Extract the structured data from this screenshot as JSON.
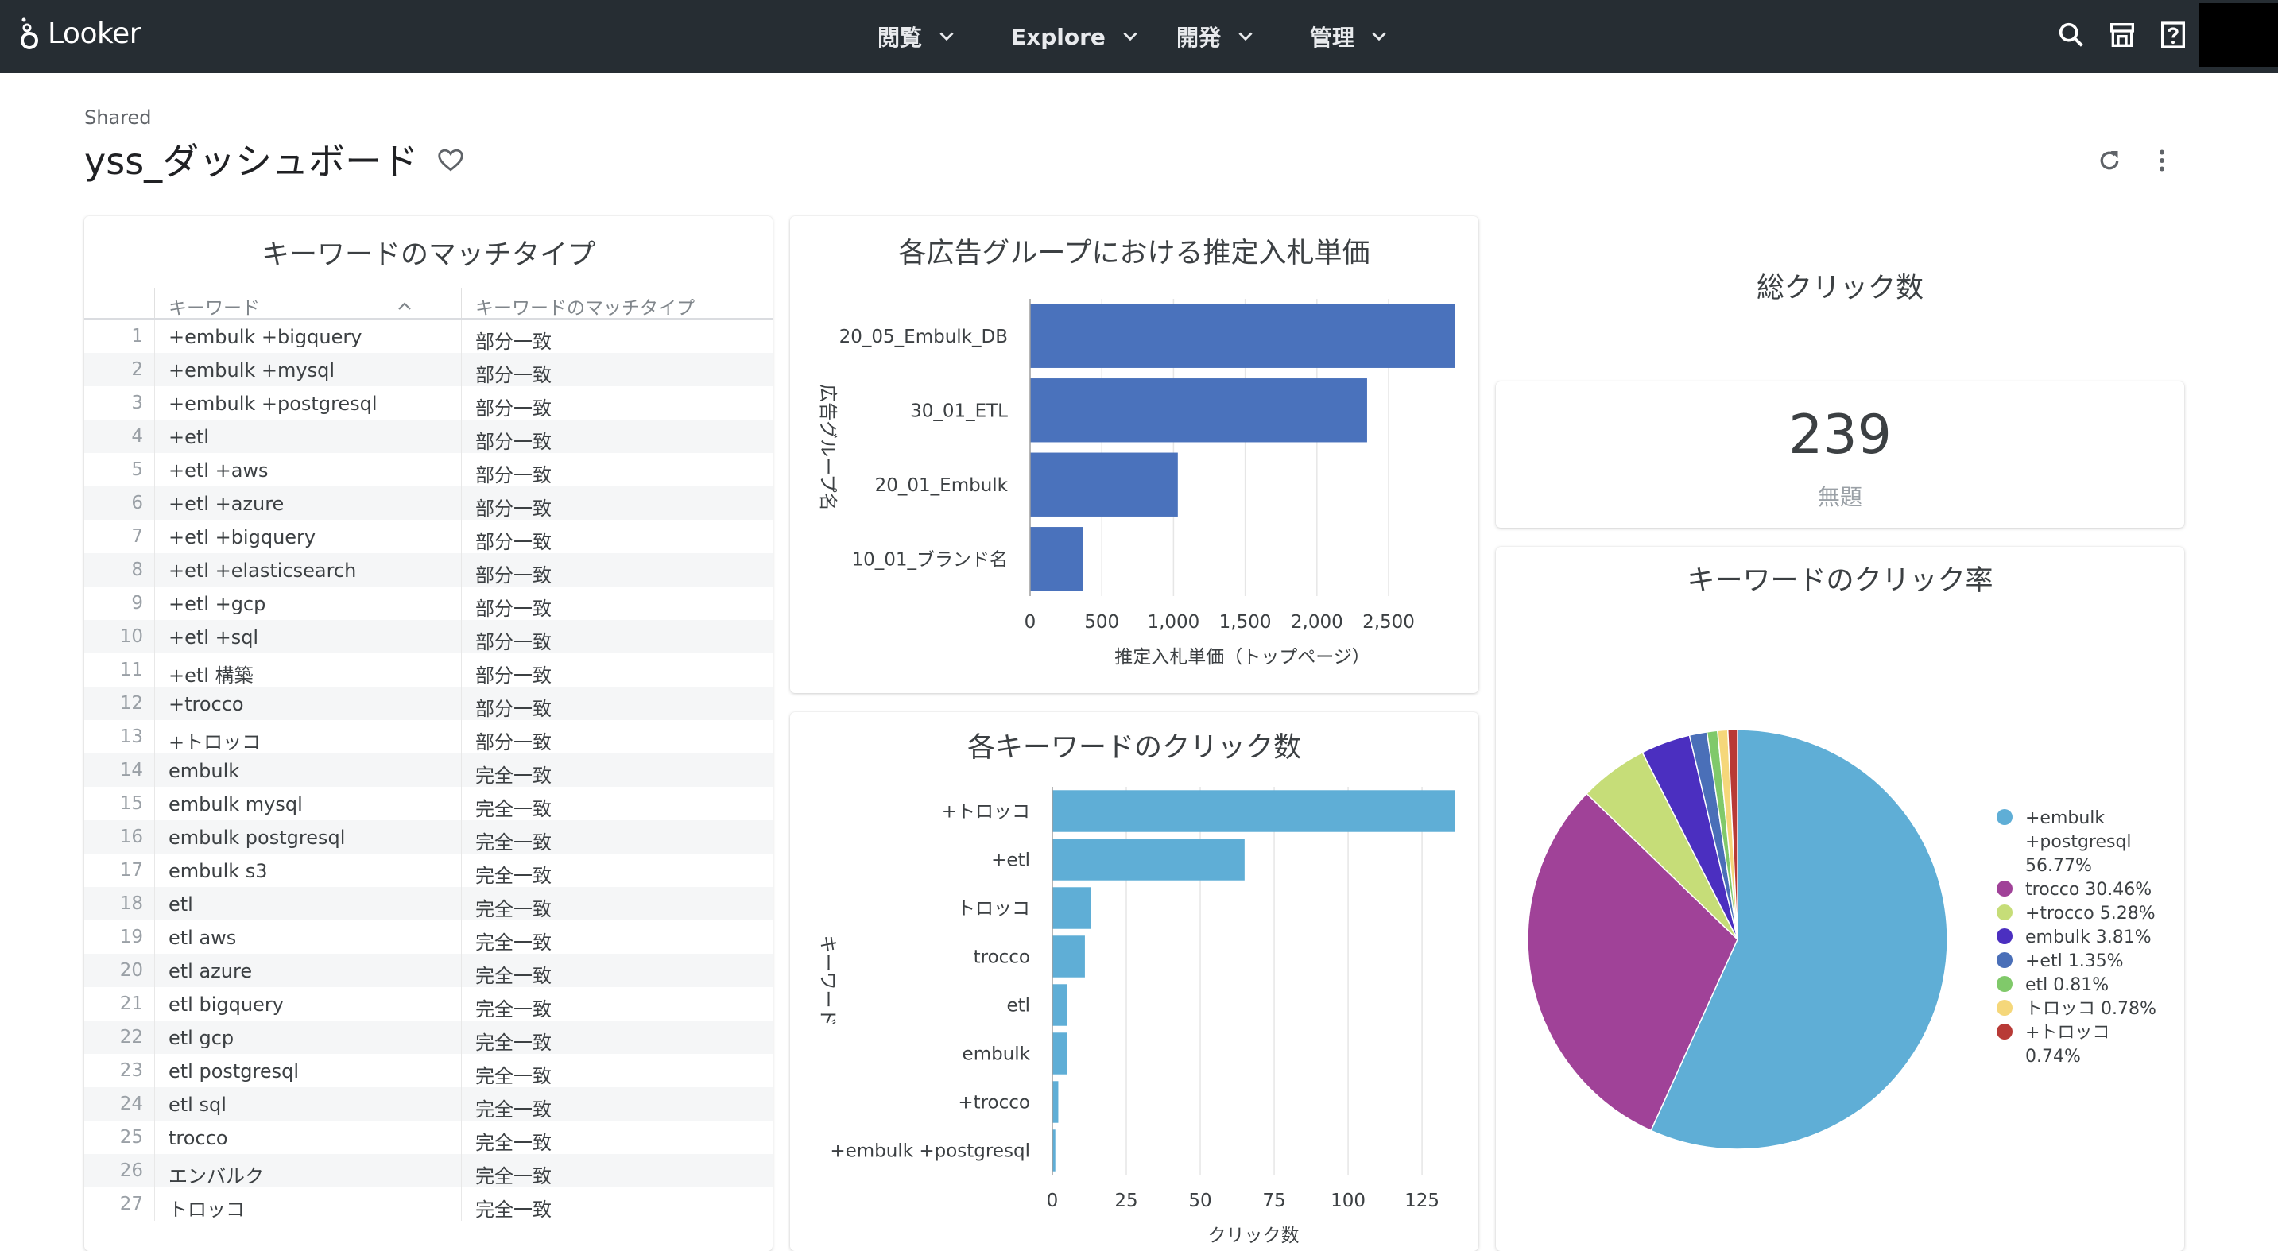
{
  "app": {
    "name": "Looker"
  },
  "nav": [
    {
      "label": "閲覧"
    },
    {
      "label": "Explore"
    },
    {
      "label": "開発"
    },
    {
      "label": "管理"
    }
  ],
  "header": {
    "breadcrumb": "Shared",
    "title": "yss_ダッシュボード"
  },
  "colors": {
    "topbar": "#262d33",
    "bid_bar": "#4a72bc",
    "click_bar": "#5faed6",
    "pie": [
      "#5faed6",
      "#a04298",
      "#c6dd78",
      "#4b2fc0",
      "#4a6fb8",
      "#80c96a",
      "#f5d77a",
      "#b83a36"
    ]
  },
  "table": {
    "title": "キーワードのマッチタイプ",
    "columns": [
      "キーワード",
      "キーワードのマッチタイプ"
    ],
    "rows": [
      {
        "n": "1",
        "keyword": "+embulk +bigquery",
        "type": "部分一致"
      },
      {
        "n": "2",
        "keyword": "+embulk +mysql",
        "type": "部分一致"
      },
      {
        "n": "3",
        "keyword": "+embulk +postgresql",
        "type": "部分一致"
      },
      {
        "n": "4",
        "keyword": "+etl",
        "type": "部分一致"
      },
      {
        "n": "5",
        "keyword": "+etl +aws",
        "type": "部分一致"
      },
      {
        "n": "6",
        "keyword": "+etl +azure",
        "type": "部分一致"
      },
      {
        "n": "7",
        "keyword": "+etl +bigquery",
        "type": "部分一致"
      },
      {
        "n": "8",
        "keyword": "+etl +elasticsearch",
        "type": "部分一致"
      },
      {
        "n": "9",
        "keyword": "+etl +gcp",
        "type": "部分一致"
      },
      {
        "n": "10",
        "keyword": "+etl +sql",
        "type": "部分一致"
      },
      {
        "n": "11",
        "keyword": "+etl 構築",
        "type": "部分一致"
      },
      {
        "n": "12",
        "keyword": "+trocco",
        "type": "部分一致"
      },
      {
        "n": "13",
        "keyword": "+トロッコ",
        "type": "部分一致"
      },
      {
        "n": "14",
        "keyword": "embulk",
        "type": "完全一致"
      },
      {
        "n": "15",
        "keyword": "embulk mysql",
        "type": "完全一致"
      },
      {
        "n": "16",
        "keyword": "embulk postgresql",
        "type": "完全一致"
      },
      {
        "n": "17",
        "keyword": "embulk s3",
        "type": "完全一致"
      },
      {
        "n": "18",
        "keyword": "etl",
        "type": "完全一致"
      },
      {
        "n": "19",
        "keyword": "etl aws",
        "type": "完全一致"
      },
      {
        "n": "20",
        "keyword": "etl azure",
        "type": "完全一致"
      },
      {
        "n": "21",
        "keyword": "etl bigquery",
        "type": "完全一致"
      },
      {
        "n": "22",
        "keyword": "etl gcp",
        "type": "完全一致"
      },
      {
        "n": "23",
        "keyword": "etl postgresql",
        "type": "完全一致"
      },
      {
        "n": "24",
        "keyword": "etl sql",
        "type": "完全一致"
      },
      {
        "n": "25",
        "keyword": "trocco",
        "type": "完全一致"
      },
      {
        "n": "26",
        "keyword": "エンバルク",
        "type": "完全一致"
      },
      {
        "n": "27",
        "keyword": "トロッコ",
        "type": "完全一致"
      }
    ]
  },
  "total": {
    "title": "総クリック数",
    "value": "239",
    "label": "無題"
  },
  "chart_data": [
    {
      "type": "bar",
      "orientation": "horizontal",
      "title": "各広告グループにおける推定入札単価",
      "xlabel": "推定入札単価（トップページ）",
      "ylabel": "広告グループ名",
      "categories": [
        "20_05_Embulk_DB",
        "30_01_ETL",
        "20_01_Embulk",
        "10_01_ブランド名"
      ],
      "values": [
        2960,
        2350,
        1030,
        370
      ],
      "xlim": [
        0,
        2960
      ],
      "xticks": [
        0,
        500,
        1000,
        1500,
        2000,
        2500
      ],
      "xtick_labels": [
        "0",
        "500",
        "1,000",
        "1,500",
        "2,000",
        "2,500"
      ],
      "grid": true
    },
    {
      "type": "bar",
      "orientation": "horizontal",
      "title": "各キーワードのクリック数",
      "xlabel": "クリック数",
      "ylabel": "キーワード",
      "categories": [
        "+トロッコ",
        "+etl",
        "トロッコ",
        "trocco",
        "etl",
        "embulk",
        "+trocco",
        "+embulk +postgresql"
      ],
      "values": [
        136,
        65,
        13,
        11,
        5,
        5,
        2,
        1
      ],
      "xlim": [
        0,
        136
      ],
      "xticks": [
        0,
        25,
        50,
        75,
        100,
        125
      ],
      "xtick_labels": [
        "0",
        "25",
        "50",
        "75",
        "100",
        "125"
      ],
      "grid": true
    },
    {
      "type": "pie",
      "title": "キーワードのクリック率",
      "legend": "right",
      "slices": [
        {
          "label": "+embulk +postgresql 56.77%",
          "value": 56.77
        },
        {
          "label": "trocco 30.46%",
          "value": 30.46
        },
        {
          "label": "+trocco 5.28%",
          "value": 5.28
        },
        {
          "label": "embulk 3.81%",
          "value": 3.81
        },
        {
          "label": "+etl 1.35%",
          "value": 1.35
        },
        {
          "label": "etl 0.81%",
          "value": 0.81
        },
        {
          "label": "トロッコ 0.78%",
          "value": 0.78
        },
        {
          "label": "+トロッコ 0.74%",
          "value": 0.74
        }
      ]
    }
  ]
}
